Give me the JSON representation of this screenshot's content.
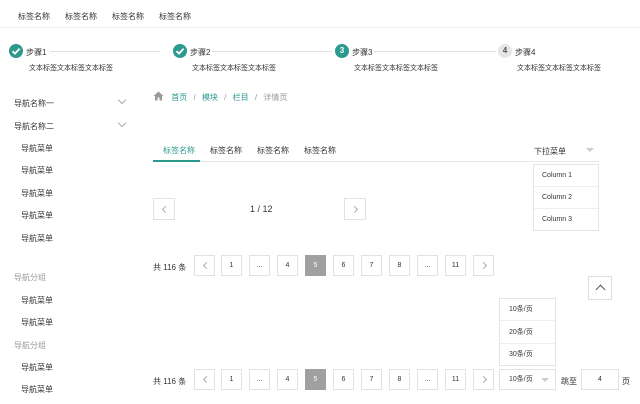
{
  "topnav": {
    "items": [
      "标签名称",
      "标签名称",
      "标签名称",
      "标签名称"
    ]
  },
  "steps": [
    {
      "title": "步骤1",
      "desc": "文本标签文本标签文本标签",
      "state": "done"
    },
    {
      "title": "步骤2",
      "desc": "文本标签文本标签文本标签",
      "state": "done"
    },
    {
      "title": "步骤3",
      "number": "3",
      "desc": "文本标签文本标签文本标签",
      "state": "active"
    },
    {
      "title": "步骤4",
      "number": "4",
      "desc": "文本标签文本标签文本标签",
      "state": "pending"
    }
  ],
  "sidebar": {
    "nav1": "导航名称一",
    "nav2": "导航名称二",
    "sub_items": [
      "导航菜单",
      "导航菜单",
      "导航菜单",
      "导航菜单",
      "导航菜单"
    ],
    "group1": "导航分组",
    "group1_items": [
      "导航菜单",
      "导航菜单"
    ],
    "group2": "导航分组",
    "group2_items": [
      "导航菜单",
      "导航菜单"
    ]
  },
  "breadcrumb": {
    "home": "首页",
    "module": "模块",
    "column": "栏目",
    "current": "详情页"
  },
  "tabs": [
    "标签名称",
    "标签名称",
    "标签名称",
    "标签名称"
  ],
  "dropdown": {
    "label": "下拉菜单",
    "options": [
      "Column 1",
      "Column 2",
      "Column 3"
    ]
  },
  "simple_pager": {
    "text": "1 / 12"
  },
  "pager1": {
    "total": "共 116 条",
    "pages": [
      "1",
      "...",
      "4",
      "5",
      "6",
      "7",
      "8",
      "...",
      "11"
    ],
    "active": "5"
  },
  "pager2": {
    "total": "共 116 条",
    "pages": [
      "1",
      "...",
      "4",
      "5",
      "6",
      "7",
      "8",
      "...",
      "11"
    ],
    "active": "5",
    "size_selected": "10条/页",
    "size_options": [
      "10条/页",
      "20条/页",
      "30条/页"
    ],
    "jump_label": "跳至",
    "jump_value": "4",
    "page_unit": "页"
  },
  "colors": {
    "accent": "#2d9a8f",
    "active_page": "#a0a0a0"
  }
}
